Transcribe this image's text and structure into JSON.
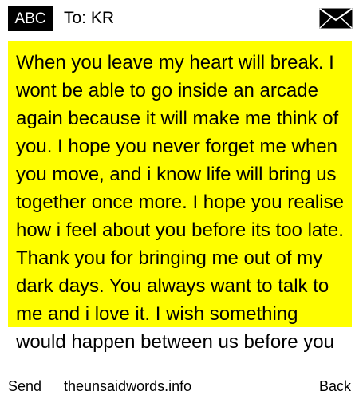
{
  "header": {
    "abc_label": "ABC",
    "recipient": "To: KR",
    "envelope_icon": "envelope-icon"
  },
  "message": {
    "body": "When you leave my heart will break. I wont be able to go inside an arcade again because it will make me think of you. I hope you never forget me when you move, and i know life will bring us together once more. I hope you realise how i feel about you before its too late. Thank you for bringing me out of my dark days. You always want to talk to me and i love it. I wish something would happen between us before you"
  },
  "footer": {
    "send_label": "Send",
    "site_label": "theunsaidwords.info",
    "back_label": "Back"
  },
  "colors": {
    "highlight": "#ffff00",
    "badge_bg": "#000000",
    "badge_text": "#ffffff"
  }
}
